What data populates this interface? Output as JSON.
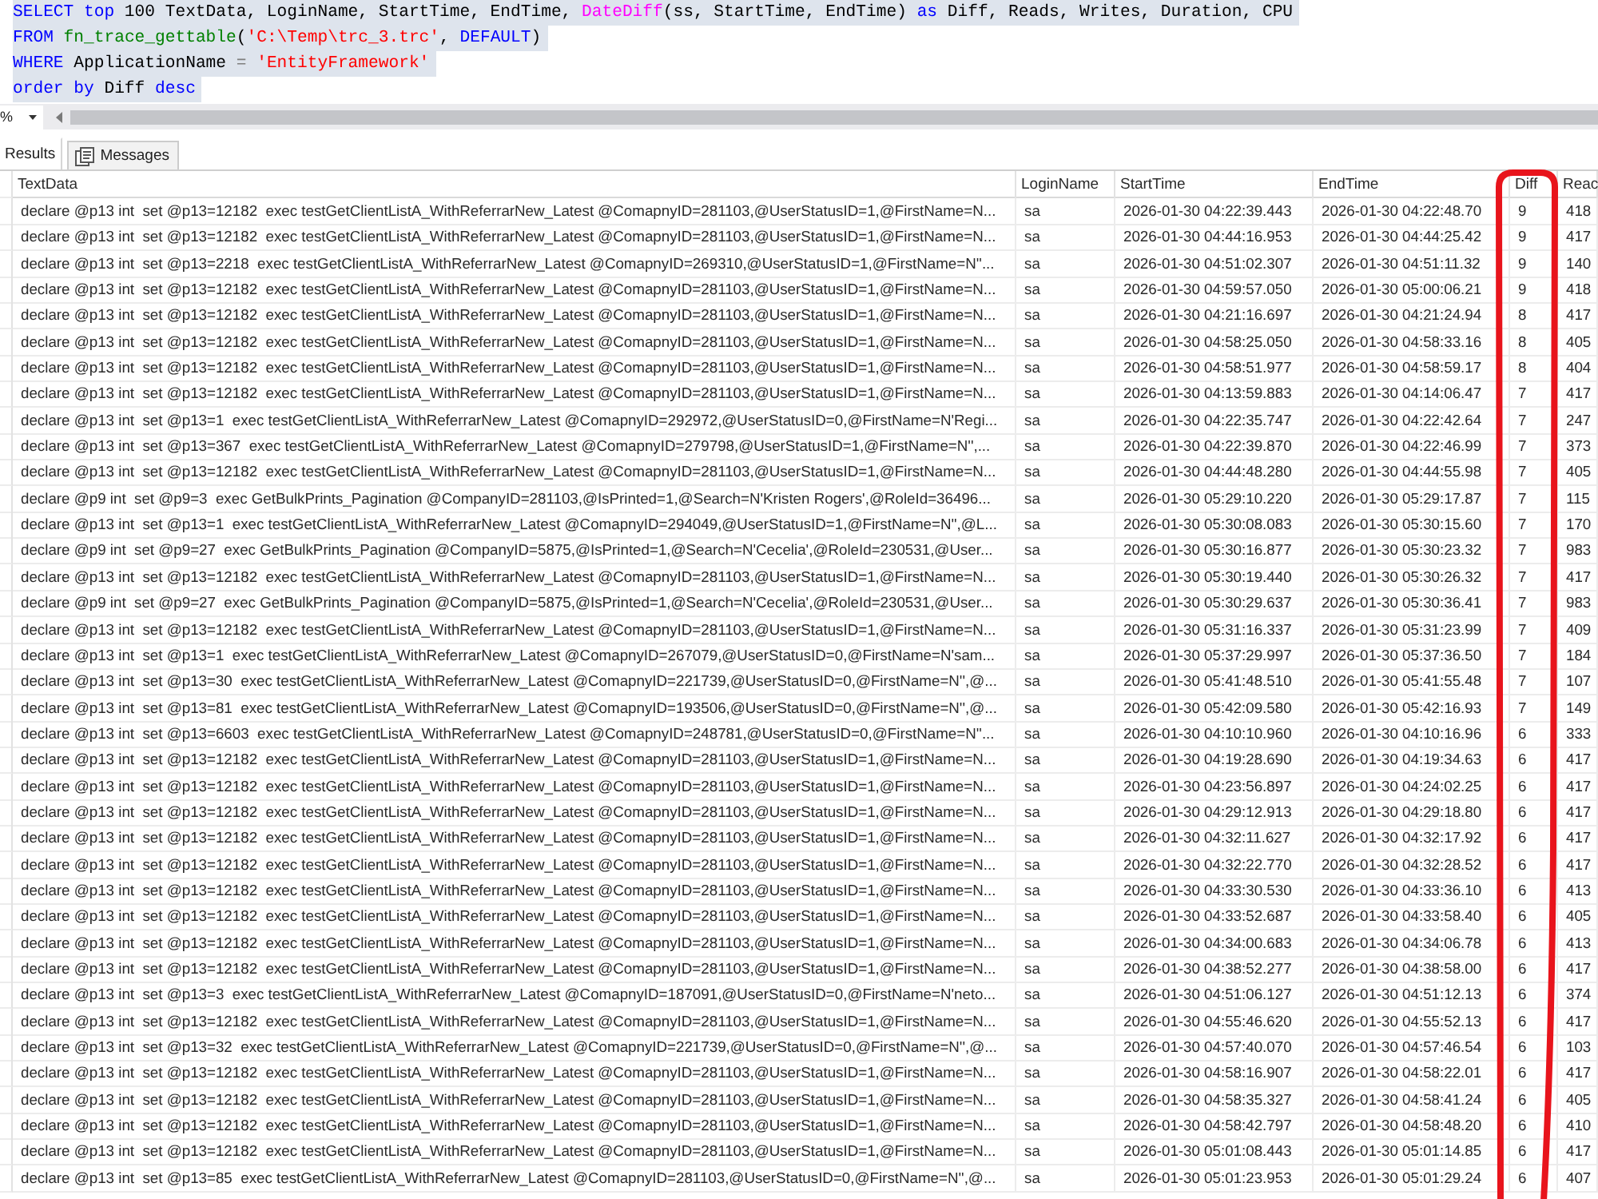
{
  "query_editor": {
    "selected": true,
    "lines": [
      {
        "tokens": [
          {
            "kind": "keyword",
            "text": "SELECT top"
          },
          {
            "kind": "plain",
            "text": " 100 TextData, LoginName, StartTime, EndTime, "
          },
          {
            "kind": "function",
            "text": "DateDiff"
          },
          {
            "kind": "plain",
            "text": "(ss, StartTime, EndTime) "
          },
          {
            "kind": "keyword",
            "text": "as"
          },
          {
            "kind": "plain",
            "text": " Diff, Reads, Writes, Duration, CPU"
          }
        ]
      },
      {
        "tokens": [
          {
            "kind": "keyword",
            "text": "FROM"
          },
          {
            "kind": "system",
            "text": " fn_trace_gettable"
          },
          {
            "kind": "plain",
            "text": "("
          },
          {
            "kind": "string",
            "text": "'C:\\Temp\\trc_3.trc'"
          },
          {
            "kind": "plain",
            "text": ", "
          },
          {
            "kind": "keyword",
            "text": "DEFAULT"
          },
          {
            "kind": "plain",
            "text": ")"
          }
        ]
      },
      {
        "tokens": [
          {
            "kind": "keyword",
            "text": "WHERE"
          },
          {
            "kind": "plain",
            "text": " ApplicationName "
          },
          {
            "kind": "operator",
            "text": "="
          },
          {
            "kind": "string",
            "text": " 'EntityFramework'"
          }
        ]
      },
      {
        "tokens": [
          {
            "kind": "keyword",
            "text": "order by"
          },
          {
            "kind": "plain",
            "text": " Diff "
          },
          {
            "kind": "keyword",
            "text": "desc"
          }
        ]
      }
    ]
  },
  "zoom_combo": {
    "value": "%"
  },
  "result_tabs": [
    {
      "label": "Results",
      "selected": true
    },
    {
      "label": "Messages",
      "selected": false
    }
  ],
  "results_grid": {
    "columns": [
      {
        "title": "TextData",
        "circled": false
      },
      {
        "title": "LoginName",
        "circled": false
      },
      {
        "title": "StartTime",
        "circled": false
      },
      {
        "title": "EndTime",
        "circled": false
      },
      {
        "title": "Diff",
        "circled": true
      },
      {
        "title": "Reac",
        "circled": false
      }
    ],
    "rows": [
      [
        "declare @p13 int  set @p13=12182  exec testGetClientListA_WithReferrarNew_Latest @ComapnyID=281103,@UserStatusID=1,@FirstName=N...",
        "sa",
        "2026-01-30 04:22:39.443",
        "2026-01-30 04:22:48.70",
        "9",
        "418"
      ],
      [
        "declare @p13 int  set @p13=12182  exec testGetClientListA_WithReferrarNew_Latest @ComapnyID=281103,@UserStatusID=1,@FirstName=N...",
        "sa",
        "2026-01-30 04:44:16.953",
        "2026-01-30 04:44:25.42",
        "9",
        "417"
      ],
      [
        "declare @p13 int  set @p13=2218  exec testGetClientListA_WithReferrarNew_Latest @ComapnyID=269310,@UserStatusID=1,@FirstName=N''...",
        "sa",
        "2026-01-30 04:51:02.307",
        "2026-01-30 04:51:11.32",
        "9",
        "140"
      ],
      [
        "declare @p13 int  set @p13=12182  exec testGetClientListA_WithReferrarNew_Latest @ComapnyID=281103,@UserStatusID=1,@FirstName=N...",
        "sa",
        "2026-01-30 04:59:57.050",
        "2026-01-30 05:00:06.21",
        "9",
        "418"
      ],
      [
        "declare @p13 int  set @p13=12182  exec testGetClientListA_WithReferrarNew_Latest @ComapnyID=281103,@UserStatusID=1,@FirstName=N...",
        "sa",
        "2026-01-30 04:21:16.697",
        "2026-01-30 04:21:24.94",
        "8",
        "417"
      ],
      [
        "declare @p13 int  set @p13=12182  exec testGetClientListA_WithReferrarNew_Latest @ComapnyID=281103,@UserStatusID=1,@FirstName=N...",
        "sa",
        "2026-01-30 04:58:25.050",
        "2026-01-30 04:58:33.16",
        "8",
        "405"
      ],
      [
        "declare @p13 int  set @p13=12182  exec testGetClientListA_WithReferrarNew_Latest @ComapnyID=281103,@UserStatusID=1,@FirstName=N...",
        "sa",
        "2026-01-30 04:58:51.977",
        "2026-01-30 04:58:59.17",
        "8",
        "404"
      ],
      [
        "declare @p13 int  set @p13=12182  exec testGetClientListA_WithReferrarNew_Latest @ComapnyID=281103,@UserStatusID=1,@FirstName=N...",
        "sa",
        "2026-01-30 04:13:59.883",
        "2026-01-30 04:14:06.47",
        "7",
        "417"
      ],
      [
        "declare @p13 int  set @p13=1  exec testGetClientListA_WithReferrarNew_Latest @ComapnyID=292972,@UserStatusID=0,@FirstName=N'Regi...",
        "sa",
        "2026-01-30 04:22:35.747",
        "2026-01-30 04:22:42.64",
        "7",
        "247"
      ],
      [
        "declare @p13 int  set @p13=367  exec testGetClientListA_WithReferrarNew_Latest @ComapnyID=279798,@UserStatusID=1,@FirstName=N'',...",
        "sa",
        "2026-01-30 04:22:39.870",
        "2026-01-30 04:22:46.99",
        "7",
        "373"
      ],
      [
        "declare @p13 int  set @p13=12182  exec testGetClientListA_WithReferrarNew_Latest @ComapnyID=281103,@UserStatusID=1,@FirstName=N...",
        "sa",
        "2026-01-30 04:44:48.280",
        "2026-01-30 04:44:55.98",
        "7",
        "405"
      ],
      [
        "declare @p9 int  set @p9=3  exec GetBulkPrints_Pagination @CompanyID=281103,@IsPrinted=1,@Search=N'Kristen Rogers',@RoleId=36496...",
        "sa",
        "2026-01-30 05:29:10.220",
        "2026-01-30 05:29:17.87",
        "7",
        "115"
      ],
      [
        "declare @p13 int  set @p13=1  exec testGetClientListA_WithReferrarNew_Latest @ComapnyID=294049,@UserStatusID=1,@FirstName=N'',@L...",
        "sa",
        "2026-01-30 05:30:08.083",
        "2026-01-30 05:30:15.60",
        "7",
        "170"
      ],
      [
        "declare @p9 int  set @p9=27  exec GetBulkPrints_Pagination @CompanyID=5875,@IsPrinted=1,@Search=N'Cecelia',@RoleId=230531,@User...",
        "sa",
        "2026-01-30 05:30:16.877",
        "2026-01-30 05:30:23.32",
        "7",
        "983"
      ],
      [
        "declare @p13 int  set @p13=12182  exec testGetClientListA_WithReferrarNew_Latest @ComapnyID=281103,@UserStatusID=1,@FirstName=N...",
        "sa",
        "2026-01-30 05:30:19.440",
        "2026-01-30 05:30:26.32",
        "7",
        "417"
      ],
      [
        "declare @p9 int  set @p9=27  exec GetBulkPrints_Pagination @CompanyID=5875,@IsPrinted=1,@Search=N'Cecelia',@RoleId=230531,@User...",
        "sa",
        "2026-01-30 05:30:29.637",
        "2026-01-30 05:30:36.41",
        "7",
        "983"
      ],
      [
        "declare @p13 int  set @p13=12182  exec testGetClientListA_WithReferrarNew_Latest @ComapnyID=281103,@UserStatusID=1,@FirstName=N...",
        "sa",
        "2026-01-30 05:31:16.337",
        "2026-01-30 05:31:23.99",
        "7",
        "409"
      ],
      [
        "declare @p13 int  set @p13=1  exec testGetClientListA_WithReferrarNew_Latest @ComapnyID=267079,@UserStatusID=0,@FirstName=N'sam...",
        "sa",
        "2026-01-30 05:37:29.997",
        "2026-01-30 05:37:36.50",
        "7",
        "184"
      ],
      [
        "declare @p13 int  set @p13=30  exec testGetClientListA_WithReferrarNew_Latest @ComapnyID=221739,@UserStatusID=0,@FirstName=N'',@...",
        "sa",
        "2026-01-30 05:41:48.510",
        "2026-01-30 05:41:55.48",
        "7",
        "107"
      ],
      [
        "declare @p13 int  set @p13=81  exec testGetClientListA_WithReferrarNew_Latest @ComapnyID=193506,@UserStatusID=0,@FirstName=N'',@...",
        "sa",
        "2026-01-30 05:42:09.580",
        "2026-01-30 05:42:16.93",
        "7",
        "149"
      ],
      [
        "declare @p13 int  set @p13=6603  exec testGetClientListA_WithReferrarNew_Latest @ComapnyID=248781,@UserStatusID=0,@FirstName=N''...",
        "sa",
        "2026-01-30 04:10:10.960",
        "2026-01-30 04:10:16.96",
        "6",
        "333"
      ],
      [
        "declare @p13 int  set @p13=12182  exec testGetClientListA_WithReferrarNew_Latest @ComapnyID=281103,@UserStatusID=1,@FirstName=N...",
        "sa",
        "2026-01-30 04:19:28.690",
        "2026-01-30 04:19:34.63",
        "6",
        "417"
      ],
      [
        "declare @p13 int  set @p13=12182  exec testGetClientListA_WithReferrarNew_Latest @ComapnyID=281103,@UserStatusID=1,@FirstName=N...",
        "sa",
        "2026-01-30 04:23:56.897",
        "2026-01-30 04:24:02.25",
        "6",
        "417"
      ],
      [
        "declare @p13 int  set @p13=12182  exec testGetClientListA_WithReferrarNew_Latest @ComapnyID=281103,@UserStatusID=1,@FirstName=N...",
        "sa",
        "2026-01-30 04:29:12.913",
        "2026-01-30 04:29:18.80",
        "6",
        "417"
      ],
      [
        "declare @p13 int  set @p13=12182  exec testGetClientListA_WithReferrarNew_Latest @ComapnyID=281103,@UserStatusID=1,@FirstName=N...",
        "sa",
        "2026-01-30 04:32:11.627",
        "2026-01-30 04:32:17.92",
        "6",
        "417"
      ],
      [
        "declare @p13 int  set @p13=12182  exec testGetClientListA_WithReferrarNew_Latest @ComapnyID=281103,@UserStatusID=1,@FirstName=N...",
        "sa",
        "2026-01-30 04:32:22.770",
        "2026-01-30 04:32:28.52",
        "6",
        "417"
      ],
      [
        "declare @p13 int  set @p13=12182  exec testGetClientListA_WithReferrarNew_Latest @ComapnyID=281103,@UserStatusID=1,@FirstName=N...",
        "sa",
        "2026-01-30 04:33:30.530",
        "2026-01-30 04:33:36.10",
        "6",
        "413"
      ],
      [
        "declare @p13 int  set @p13=12182  exec testGetClientListA_WithReferrarNew_Latest @ComapnyID=281103,@UserStatusID=1,@FirstName=N...",
        "sa",
        "2026-01-30 04:33:52.687",
        "2026-01-30 04:33:58.40",
        "6",
        "405"
      ],
      [
        "declare @p13 int  set @p13=12182  exec testGetClientListA_WithReferrarNew_Latest @ComapnyID=281103,@UserStatusID=1,@FirstName=N...",
        "sa",
        "2026-01-30 04:34:00.683",
        "2026-01-30 04:34:06.78",
        "6",
        "413"
      ],
      [
        "declare @p13 int  set @p13=12182  exec testGetClientListA_WithReferrarNew_Latest @ComapnyID=281103,@UserStatusID=1,@FirstName=N...",
        "sa",
        "2026-01-30 04:38:52.277",
        "2026-01-30 04:38:58.00",
        "6",
        "417"
      ],
      [
        "declare @p13 int  set @p13=3  exec testGetClientListA_WithReferrarNew_Latest @ComapnyID=187091,@UserStatusID=0,@FirstName=N'neto...",
        "sa",
        "2026-01-30 04:51:06.127",
        "2026-01-30 04:51:12.13",
        "6",
        "374"
      ],
      [
        "declare @p13 int  set @p13=12182  exec testGetClientListA_WithReferrarNew_Latest @ComapnyID=281103,@UserStatusID=1,@FirstName=N...",
        "sa",
        "2026-01-30 04:55:46.620",
        "2026-01-30 04:55:52.13",
        "6",
        "417"
      ],
      [
        "declare @p13 int  set @p13=32  exec testGetClientListA_WithReferrarNew_Latest @ComapnyID=221739,@UserStatusID=0,@FirstName=N'',@...",
        "sa",
        "2026-01-30 04:57:40.070",
        "2026-01-30 04:57:46.54",
        "6",
        "103"
      ],
      [
        "declare @p13 int  set @p13=12182  exec testGetClientListA_WithReferrarNew_Latest @ComapnyID=281103,@UserStatusID=1,@FirstName=N...",
        "sa",
        "2026-01-30 04:58:16.907",
        "2026-01-30 04:58:22.01",
        "6",
        "417"
      ],
      [
        "declare @p13 int  set @p13=12182  exec testGetClientListA_WithReferrarNew_Latest @ComapnyID=281103,@UserStatusID=1,@FirstName=N...",
        "sa",
        "2026-01-30 04:58:35.327",
        "2026-01-30 04:58:41.24",
        "6",
        "405"
      ],
      [
        "declare @p13 int  set @p13=12182  exec testGetClientListA_WithReferrarNew_Latest @ComapnyID=281103,@UserStatusID=1,@FirstName=N...",
        "sa",
        "2026-01-30 04:58:42.797",
        "2026-01-30 04:58:48.20",
        "6",
        "410"
      ],
      [
        "declare @p13 int  set @p13=12182  exec testGetClientListA_WithReferrarNew_Latest @ComapnyID=281103,@UserStatusID=1,@FirstName=N...",
        "sa",
        "2026-01-30 05:01:08.443",
        "2026-01-30 05:01:14.85",
        "6",
        "417"
      ],
      [
        "declare @p13 int  set @p13=85  exec testGetClientListA_WithReferrarNew_Latest @ComapnyID=281103,@UserStatusID=0,@FirstName=N'',@...",
        "sa",
        "2026-01-30 05:01:23.953",
        "2026-01-30 05:01:29.24",
        "6",
        "407"
      ]
    ]
  }
}
